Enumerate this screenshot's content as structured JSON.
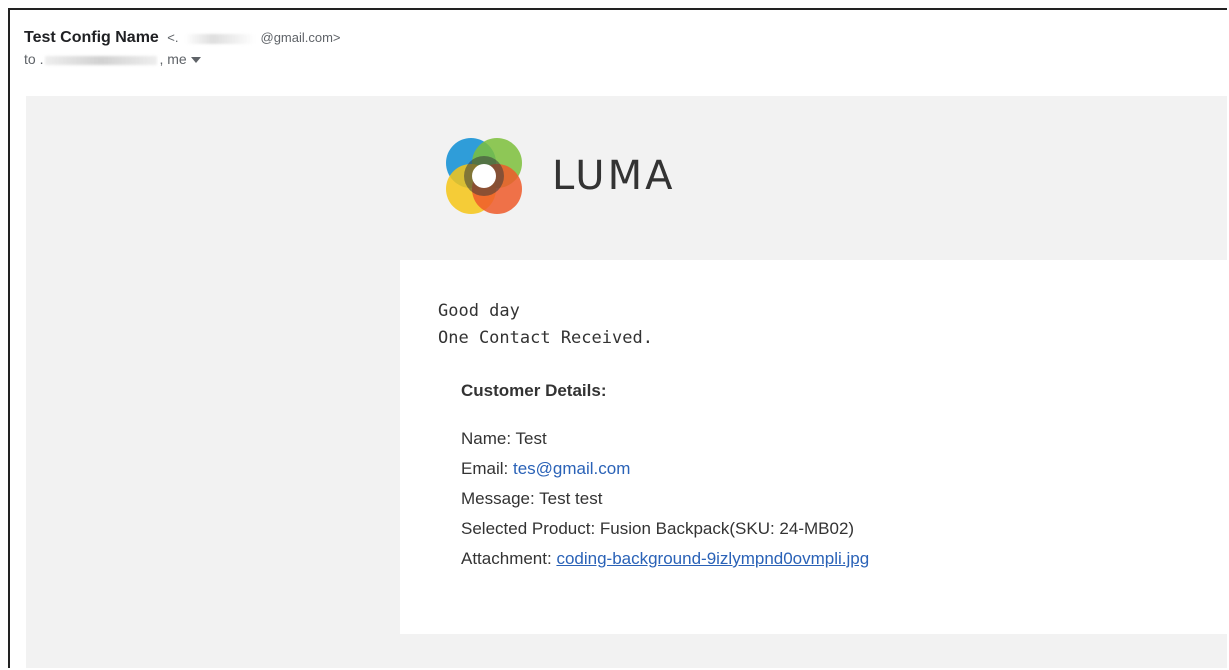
{
  "header": {
    "sender_name": "Test Config Name",
    "sender_email_open": "<.",
    "sender_email_domain": "@gmail.com>",
    "to_prefix": "to .",
    "to_suffix": ", me"
  },
  "brand": {
    "logo_text": "LUMA",
    "colors": {
      "blue": "#1e96d7",
      "green": "#7cbf3b",
      "yellow": "#f6c616",
      "orange": "#ee5a2a",
      "center": "#3b3b3b"
    }
  },
  "message": {
    "greeting": "Good day",
    "intro": "One Contact Received.",
    "details_title": "Customer Details:",
    "name_label": "Name: ",
    "name_value": "Test",
    "email_label": "Email: ",
    "email_value": "tes@gmail.com",
    "message_label": "Message: ",
    "message_value": "Test test",
    "product_label": "Selected Product: ",
    "product_value": "Fusion Backpack(SKU: 24-MB02)",
    "attachment_label": "Attachment: ",
    "attachment_value": "coding-background-9izlympnd0ovmpli.jpg"
  },
  "colors": {
    "link": "#2a62b7",
    "email_background": "#f2f2f2",
    "text": "#333333"
  }
}
